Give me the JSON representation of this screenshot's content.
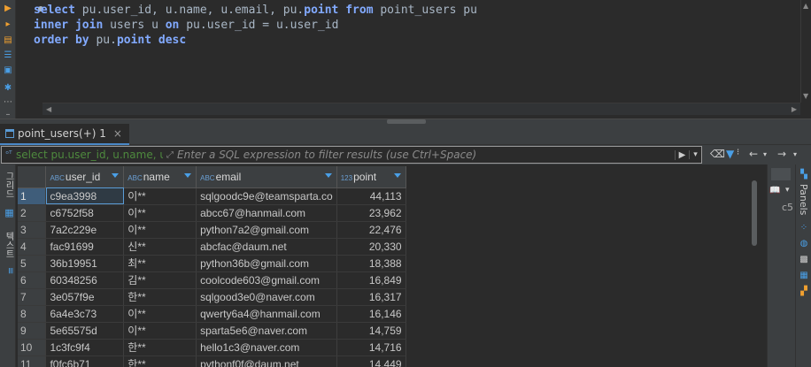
{
  "editor": {
    "lines": [
      [
        {
          "t": "select",
          "k": true
        },
        {
          "t": " pu.user_id, u.name, u.email, pu.",
          "k": false
        },
        {
          "t": "point",
          "k": true
        },
        {
          "t": " ",
          "k": false
        },
        {
          "t": "from",
          "k": true
        },
        {
          "t": " point_users pu",
          "k": false
        }
      ],
      [
        {
          "t": "inner join",
          "k": true
        },
        {
          "t": " users u ",
          "k": false
        },
        {
          "t": "on",
          "k": true
        },
        {
          "t": " pu.user_id = u.user_id",
          "k": false
        }
      ],
      [
        {
          "t": "order by",
          "k": true
        },
        {
          "t": " pu.",
          "k": false
        },
        {
          "t": "point",
          "k": true
        },
        {
          "t": " ",
          "k": false
        },
        {
          "t": "desc",
          "k": true
        }
      ]
    ]
  },
  "result_tab": {
    "label": "point_users(+) 1",
    "close": "×"
  },
  "filter": {
    "hint": "select pu.user_id, u.name, u.en",
    "placeholder": "Enter a SQL expression to filter results (use Ctrl+Space)"
  },
  "vtabs": {
    "grid": "그리드",
    "text": "텍스트"
  },
  "side_panel": {
    "label": "Panels",
    "cs_text": "c5"
  },
  "grid": {
    "columns": [
      {
        "name": "user_id",
        "type": "ABC"
      },
      {
        "name": "name",
        "type": "ABC"
      },
      {
        "name": "email",
        "type": "ABC"
      },
      {
        "name": "point",
        "type": "123"
      }
    ],
    "rows": [
      [
        "1",
        "c9ea3998",
        "이**",
        "sqlgoodc9e@teamsparta.co",
        "44,113"
      ],
      [
        "2",
        "c6752f58",
        "이**",
        "abcc67@hanmail.com",
        "23,962"
      ],
      [
        "3",
        "7a2c229e",
        "이**",
        "python7a2@gmail.com",
        "22,476"
      ],
      [
        "4",
        "fac91699",
        "신**",
        "abcfac@daum.net",
        "20,330"
      ],
      [
        "5",
        "36b19951",
        "최**",
        "python36b@gmail.com",
        "18,388"
      ],
      [
        "6",
        "60348256",
        "김**",
        "coolcode603@gmail.com",
        "16,849"
      ],
      [
        "7",
        "3e057f9e",
        "한**",
        "sqlgood3e0@naver.com",
        "16,317"
      ],
      [
        "8",
        "6a4e3c73",
        "이**",
        "qwerty6a4@hanmail.com",
        "16,146"
      ],
      [
        "9",
        "5e65575d",
        "이**",
        "sparta5e6@naver.com",
        "14,759"
      ],
      [
        "10",
        "1c3fc9f4",
        "한**",
        "hello1c3@naver.com",
        "14,716"
      ],
      [
        "11",
        "f0fc6b71",
        "한**",
        "pythonf0f@daum.net",
        "14,449"
      ]
    ]
  },
  "colors": {
    "keyword": "#82aaff",
    "accent": "#4a9fe6",
    "selection": "#3f5d7a"
  }
}
